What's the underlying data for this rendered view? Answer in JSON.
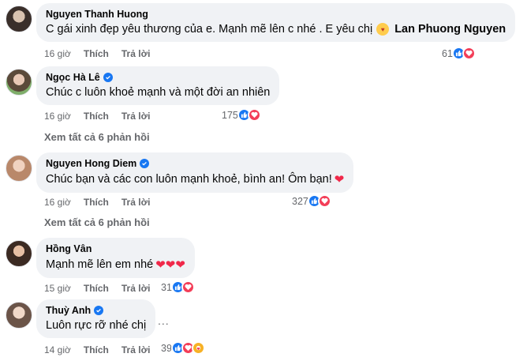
{
  "comments": [
    {
      "author": "Nguyen Thanh Huong",
      "verified": false,
      "text": "C gái xinh đẹp yêu thương của e. Mạnh mẽ lên c nhé . E yêu chị",
      "mention": "Lan Phuong Nguyen",
      "time": "16 giờ",
      "like_label": "Thích",
      "reply_label": "Trả lời",
      "reaction_count": "61",
      "reactions": [
        "like-icon",
        "love-icon"
      ]
    },
    {
      "author": "Ngọc Hà Lê",
      "verified": true,
      "text": "Chúc c luôn khoẻ mạnh và một đời an nhiên",
      "time": "16 giờ",
      "like_label": "Thích",
      "reply_label": "Trả lời",
      "reaction_count": "175",
      "reactions": [
        "like-icon",
        "love-icon"
      ],
      "view_replies": "Xem tất cả 6 phản hồi"
    },
    {
      "author": "Nguyen Hong Diem",
      "verified": true,
      "text": "Chúc bạn và các con luôn mạnh khoẻ, bình an! Ôm bạn!",
      "time": "16 giờ",
      "like_label": "Thích",
      "reply_label": "Trả lời",
      "reaction_count": "327",
      "reactions": [
        "like-icon",
        "love-icon"
      ],
      "view_replies": "Xem tất cả 6 phản hồi"
    },
    {
      "author": "Hồng Vân",
      "verified": false,
      "text": "Mạnh mẽ lên em nhé",
      "time": "15 giờ",
      "like_label": "Thích",
      "reply_label": "Trả lời",
      "reaction_count": "31",
      "reactions": [
        "like-icon",
        "love-icon"
      ]
    },
    {
      "author": "Thuỳ Anh",
      "verified": true,
      "text": "Luôn rực rỡ nhé chị",
      "time": "14 giờ",
      "like_label": "Thích",
      "reply_label": "Trả lời",
      "reaction_count": "39",
      "reactions": [
        "like-icon",
        "love-icon",
        "care-icon"
      ]
    }
  ],
  "more_options": "...",
  "colors": {
    "like": "#1877f2",
    "love": "#f33e58",
    "care": "#f7b125",
    "meta": "#65676b",
    "bubble": "#f0f2f5"
  }
}
